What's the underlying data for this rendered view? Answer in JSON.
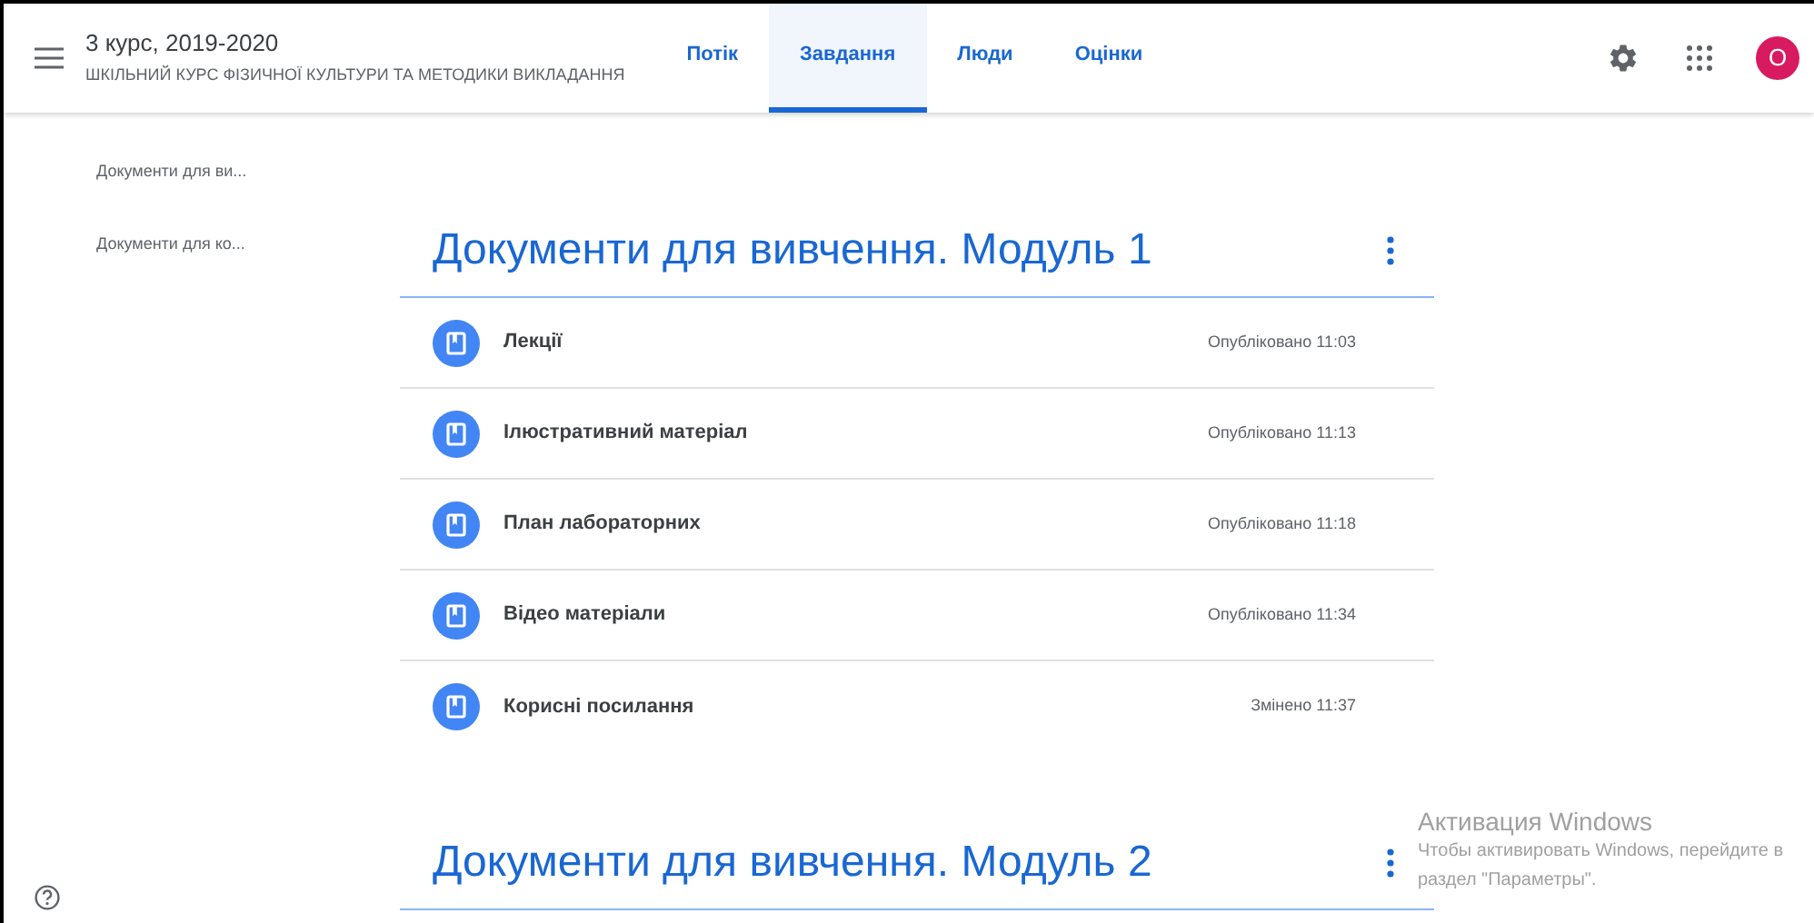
{
  "header": {
    "title": "3 курс, 2019-2020",
    "subtitle": "ШКІЛЬНИЙ КУРС ФІЗИЧНОЇ КУЛЬТУРИ ТА МЕТОДИКИ ВИКЛАДАННЯ",
    "avatar": "О"
  },
  "tabs": [
    {
      "label": "Потік",
      "selected": false
    },
    {
      "label": "Завдання",
      "selected": true
    },
    {
      "label": "Люди",
      "selected": false
    },
    {
      "label": "Оцінки",
      "selected": false
    }
  ],
  "sidebar": {
    "items": [
      "Документи для ви...",
      "Документи для ко..."
    ]
  },
  "topics": [
    {
      "title": "Документи для вивчення. Модуль 1",
      "items": [
        {
          "title": "Лекції",
          "status": "Опубліковано 11:03"
        },
        {
          "title": "Ілюстративний матеріал",
          "status": "Опубліковано 11:13"
        },
        {
          "title": "План лабораторних",
          "status": "Опубліковано 11:18"
        },
        {
          "title": "Відео матеріали",
          "status": "Опубліковано 11:34"
        },
        {
          "title": "Корисні посилання",
          "status": "Змінено 11:37"
        }
      ]
    },
    {
      "title": "Документи для вивчення. Модуль 2"
    }
  ],
  "activation_notice": {
    "title": "Активация Windows",
    "text": "Чтобы активировать Windows, перейдите в раздел \"Параметры\"."
  }
}
